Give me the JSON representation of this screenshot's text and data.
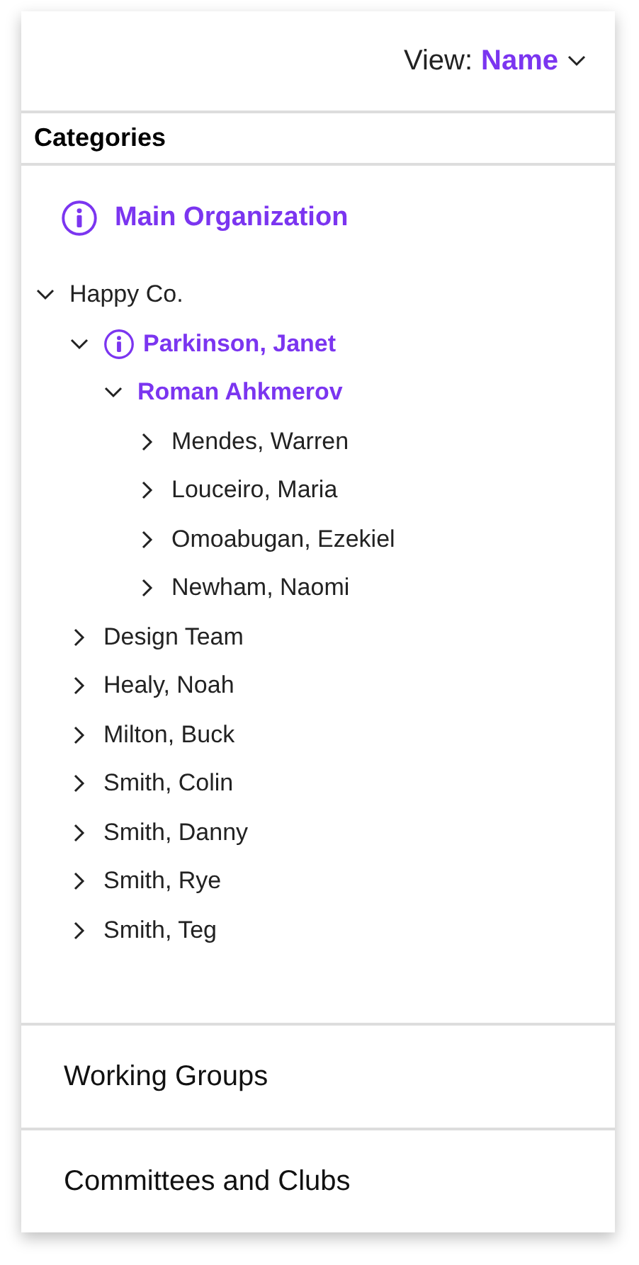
{
  "header": {
    "view_label": "View:",
    "view_value": "Name"
  },
  "categories": {
    "title": "Categories",
    "root": {
      "label": "Main Organization",
      "has_info": true
    },
    "tree": [
      {
        "label": "Happy Co.",
        "expanded": true,
        "selected": false,
        "has_info": false,
        "children": [
          {
            "label": "Parkinson, Janet",
            "expanded": true,
            "selected": true,
            "has_info": true,
            "children": [
              {
                "label": "Roman Ahkmerov",
                "expanded": true,
                "selected": true,
                "has_info": false,
                "children": [
                  {
                    "label": "Mendes, Warren",
                    "expanded": false,
                    "selected": false,
                    "has_info": false
                  },
                  {
                    "label": "Louceiro, Maria",
                    "expanded": false,
                    "selected": false,
                    "has_info": false
                  },
                  {
                    "label": "Omoabugan, Ezekiel",
                    "expanded": false,
                    "selected": false,
                    "has_info": false
                  },
                  {
                    "label": "Newham, Naomi",
                    "expanded": false,
                    "selected": false,
                    "has_info": false
                  }
                ]
              }
            ]
          },
          {
            "label": "Design Team",
            "expanded": false,
            "selected": false,
            "has_info": false
          },
          {
            "label": "Healy, Noah",
            "expanded": false,
            "selected": false,
            "has_info": false
          },
          {
            "label": "Milton, Buck",
            "expanded": false,
            "selected": false,
            "has_info": false
          },
          {
            "label": "Smith, Colin",
            "expanded": false,
            "selected": false,
            "has_info": false
          },
          {
            "label": "Smith, Danny",
            "expanded": false,
            "selected": false,
            "has_info": false
          },
          {
            "label": "Smith, Rye",
            "expanded": false,
            "selected": false,
            "has_info": false
          },
          {
            "label": "Smith, Teg",
            "expanded": false,
            "selected": false,
            "has_info": false
          }
        ]
      }
    ]
  },
  "sections": [
    {
      "label": "Working Groups"
    },
    {
      "label": "Committees and Clubs"
    }
  ]
}
